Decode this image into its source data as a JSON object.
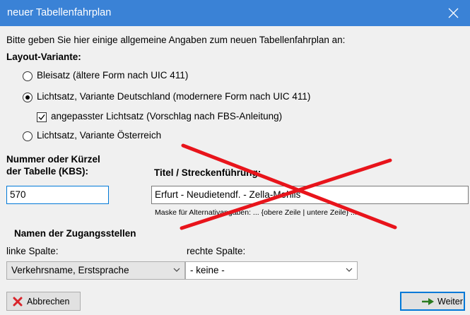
{
  "window": {
    "title": "neuer Tabellenfahrplan",
    "titlebar_color": "#3a82d6"
  },
  "intro": "Bitte geben Sie hier einige allgemeine Angaben zum neuen Tabellenfahrplan an:",
  "layout": {
    "heading": "Layout-Variante:",
    "options": [
      {
        "label": "Bleisatz (ältere Form nach UIC 411)",
        "checked": false
      },
      {
        "label": "Lichtsatz, Variante Deutschland (modernere Form nach UIC 411)",
        "checked": true
      },
      {
        "label": "Lichtsatz, Variante Österreich",
        "checked": false
      }
    ],
    "adapted_checkbox": {
      "label": "angepasster Lichtsatz (Vorschlag nach FBS-Anleitung)",
      "checked": true
    }
  },
  "kbs": {
    "label_line1": "Nummer oder Kürzel",
    "label_line2": "der Tabelle (KBS):",
    "value": "570"
  },
  "route": {
    "label": "Titel / Streckenführung:",
    "value": "Erfurt - Neudietendf. - Zella-Mehlis",
    "mask_hint": "Maske für Alternativangaben: ... {obere Zeile | untere Zeile} ..."
  },
  "stations": {
    "heading": "Namen der Zugangsstellen",
    "left_label": "linke Spalte:",
    "left_value": "Verkehrsname, Erstsprache",
    "right_label": "rechte Spalte:",
    "right_value": "- keine -"
  },
  "buttons": {
    "cancel": "Abbrechen",
    "next": "Weiter"
  },
  "colors": {
    "cross_out": "#e8141b",
    "focus_border": "#0078d7",
    "cancel_icon": "#d9242b",
    "next_icon": "#2b7a1f"
  }
}
